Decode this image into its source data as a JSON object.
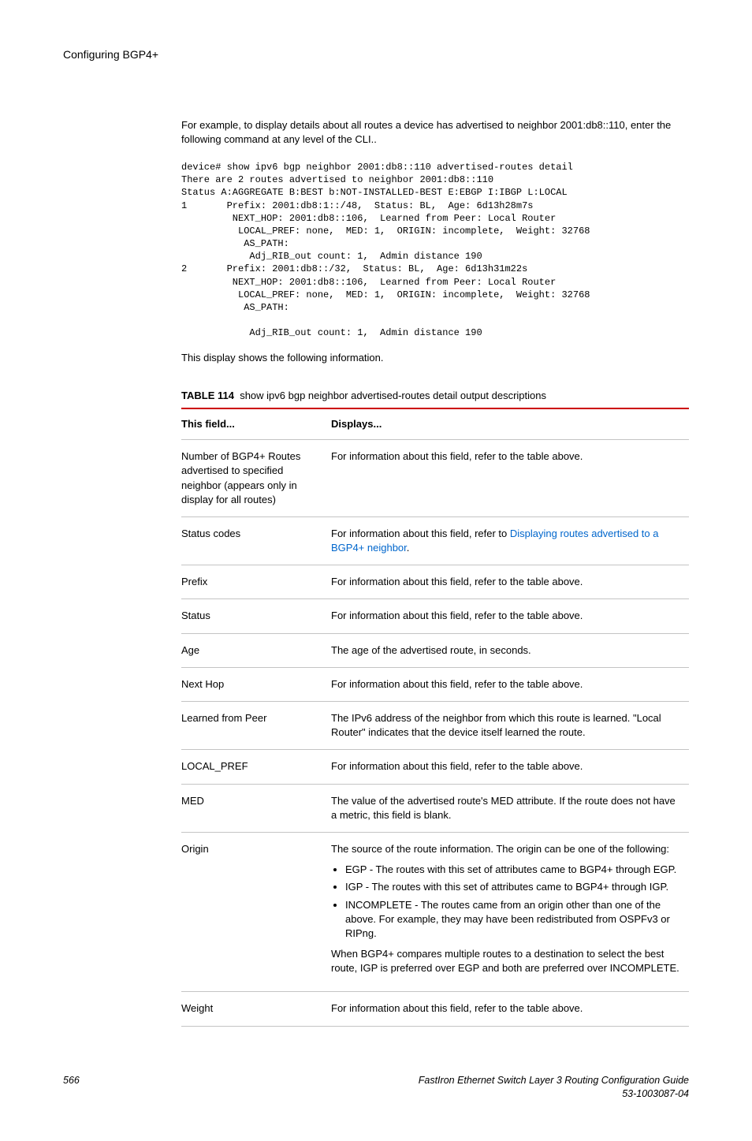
{
  "header": {
    "title": "Configuring BGP4+"
  },
  "intro": "For example, to display details about all routes a device has advertised to neighbor 2001:db8::110, enter the following command at any level of the CLI..",
  "code": "device# show ipv6 bgp neighbor 2001:db8::110 advertised-routes detail\nThere are 2 routes advertised to neighbor 2001:db8::110\nStatus A:AGGREGATE B:BEST b:NOT-INSTALLED-BEST E:EBGP I:IBGP L:LOCAL\n1       Prefix: 2001:db8:1::/48,  Status: BL,  Age: 6d13h28m7s\n         NEXT_HOP: 2001:db8::106,  Learned from Peer: Local Router\n          LOCAL_PREF: none,  MED: 1,  ORIGIN: incomplete,  Weight: 32768\n           AS_PATH:\n            Adj_RIB_out count: 1,  Admin distance 190\n2       Prefix: 2001:db8::/32,  Status: BL,  Age: 6d13h31m22s\n         NEXT_HOP: 2001:db8::106,  Learned from Peer: Local Router\n          LOCAL_PREF: none,  MED: 1,  ORIGIN: incomplete,  Weight: 32768\n           AS_PATH:\n\n            Adj_RIB_out count: 1,  Admin distance 190",
  "after_code": "This display shows the following information.",
  "table": {
    "caption_label": "TABLE 114",
    "caption_text": "show ipv6 bgp neighbor advertised-routes detail output descriptions",
    "col1": "This field...",
    "col2": "Displays...",
    "rows": {
      "r0": {
        "field": "Number of BGP4+ Routes advertised to specified neighbor (appears only in display for all routes)",
        "desc": "For information about this field, refer to the table above."
      },
      "r1": {
        "field": "Status codes",
        "desc_pre": "For information about this field, refer to ",
        "desc_link": "Displaying routes advertised to a BGP4+ neighbor",
        "desc_post": "."
      },
      "r2": {
        "field": "Prefix",
        "desc": "For information about this field, refer to the table above."
      },
      "r3": {
        "field": "Status",
        "desc": "For information about this field, refer to the table above."
      },
      "r4": {
        "field": "Age",
        "desc": "The age of the advertised route, in seconds."
      },
      "r5": {
        "field": "Next Hop",
        "desc": "For information about this field, refer to the table above."
      },
      "r6": {
        "field": "Learned from Peer",
        "desc": "The IPv6 address of the neighbor from which this route is learned. \"Local Router\" indicates that the device itself learned the route."
      },
      "r7": {
        "field": "LOCAL_PREF",
        "desc": "For information about this field, refer to the table above."
      },
      "r8": {
        "field": "MED",
        "desc": "The value of the advertised route's MED attribute. If the route does not have a metric, this field is blank."
      },
      "r9": {
        "field": "Origin",
        "p1": "The source of the route information. The origin can be one of the following:",
        "b1": "EGP - The routes with this set of attributes came to BGP4+ through EGP.",
        "b2": "IGP - The routes with this set of attributes came to BGP4+ through IGP.",
        "b3": "INCOMPLETE - The routes came from an origin other than one of the above. For example, they may have been redistributed from OSPFv3 or RIPng.",
        "p2": "When BGP4+ compares multiple routes to a destination to select the best route, IGP is preferred over EGP and both are preferred over INCOMPLETE."
      },
      "r10": {
        "field": "Weight",
        "desc": "For information about this field, refer to the table above."
      }
    }
  },
  "footer": {
    "page": "566",
    "doc_title": "FastIron Ethernet Switch Layer 3 Routing Configuration Guide",
    "doc_num": "53-1003087-04"
  }
}
